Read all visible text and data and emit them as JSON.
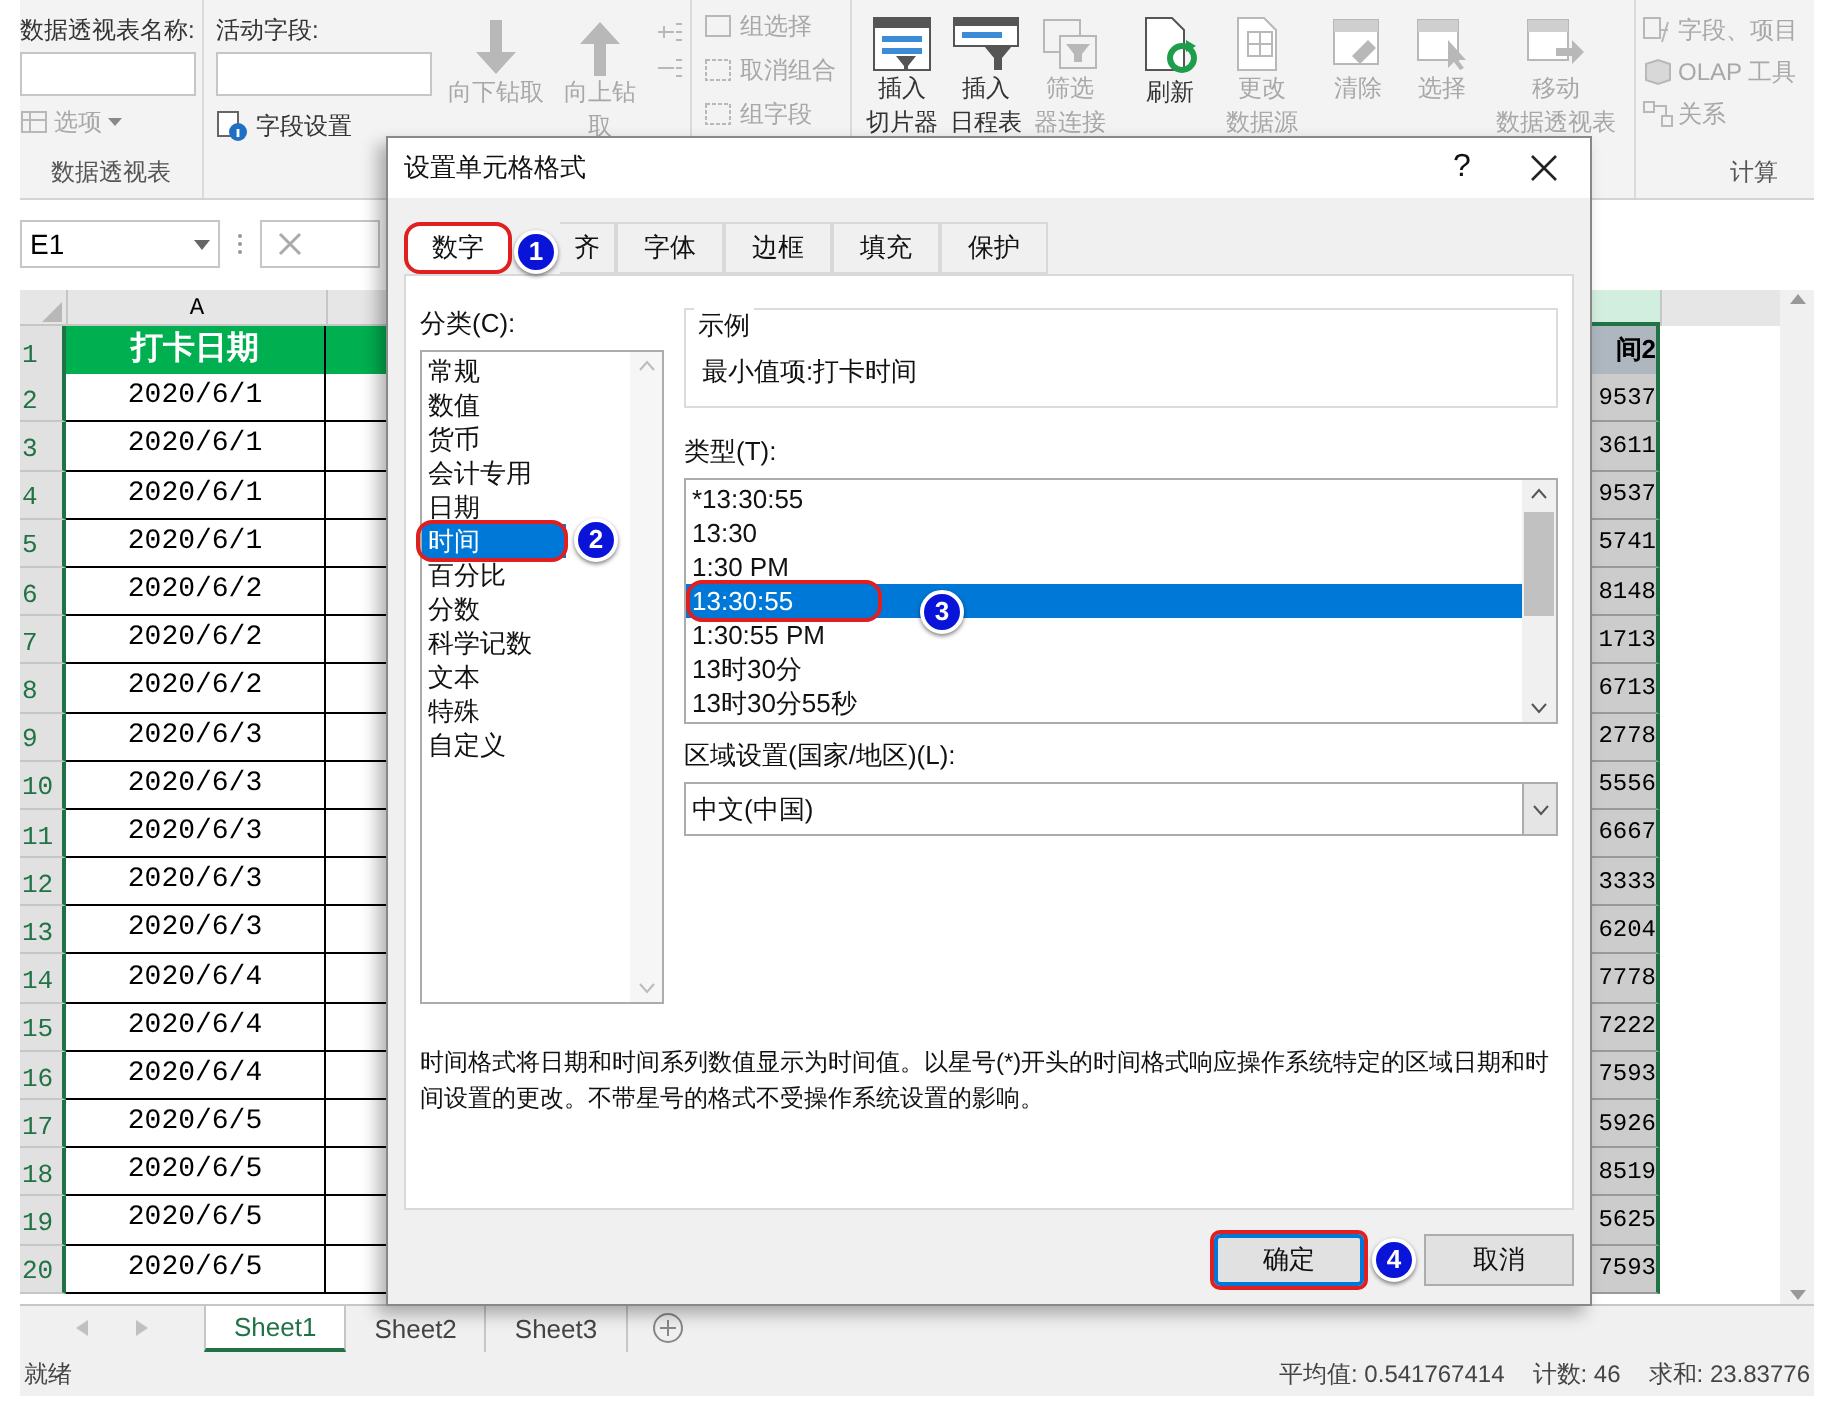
{
  "ribbon": {
    "pivot_name_label": "数据透视表名称:",
    "options": {
      "label": "选项",
      "disabled": true
    },
    "pivot_group_label": "数据透视表",
    "active_field_label": "活动字段:",
    "field_settings": "字段设置",
    "drill_buttons": [
      {
        "kind": "down",
        "lines": [
          "向下钻取"
        ],
        "disabled": true
      },
      {
        "kind": "up",
        "lines": [
          "向上钻",
          "取"
        ],
        "disabled": true
      }
    ],
    "group_commands": [
      {
        "label": "组选择",
        "disabled": true
      },
      {
        "label": "取消组合",
        "disabled": true
      },
      {
        "label": "组字段",
        "disabled": true
      }
    ],
    "large_buttons": [
      {
        "kind": "slicer",
        "lines": [
          "插入",
          "切片器"
        ],
        "disabled": false
      },
      {
        "kind": "timeline",
        "lines": [
          "插入",
          "日程表"
        ],
        "disabled": false
      },
      {
        "kind": "filter",
        "lines": [
          "筛选",
          "器连接"
        ],
        "disabled": true
      },
      {
        "kind": "refresh",
        "lines": [
          "刷新"
        ],
        "disabled": false
      },
      {
        "kind": "source",
        "lines": [
          "更改",
          "数据源"
        ],
        "disabled": true
      },
      {
        "kind": "clear",
        "lines": [
          "清除"
        ],
        "disabled": true
      },
      {
        "kind": "select",
        "lines": [
          "选择"
        ],
        "disabled": true
      },
      {
        "kind": "move",
        "lines": [
          "移动",
          "数据透视表"
        ],
        "disabled": true
      }
    ],
    "calc_commands": [
      {
        "kind": "fx",
        "label": "字段、项目"
      },
      {
        "kind": "olap",
        "label": "OLAP 工具"
      },
      {
        "kind": "relation",
        "label": "关系"
      }
    ],
    "calc_group_label": "计算"
  },
  "name_box": "E1",
  "column_headers": [
    "A"
  ],
  "header_row": {
    "a": "打卡日期",
    "e": "间2"
  },
  "rows": [
    {
      "num": "1"
    },
    {
      "num": "2",
      "a": "2020/6/1",
      "e": "9537"
    },
    {
      "num": "3",
      "a": "2020/6/1",
      "e": "3611"
    },
    {
      "num": "4",
      "a": "2020/6/1",
      "e": "9537"
    },
    {
      "num": "5",
      "a": "2020/6/1",
      "e": "5741"
    },
    {
      "num": "6",
      "a": "2020/6/2",
      "e": "8148"
    },
    {
      "num": "7",
      "a": "2020/6/2",
      "e": "1713"
    },
    {
      "num": "8",
      "a": "2020/6/2",
      "e": "6713"
    },
    {
      "num": "9",
      "a": "2020/6/3",
      "e": "2778"
    },
    {
      "num": "10",
      "a": "2020/6/3",
      "e": "5556"
    },
    {
      "num": "11",
      "a": "2020/6/3",
      "e": "6667"
    },
    {
      "num": "12",
      "a": "2020/6/3",
      "e": "3333"
    },
    {
      "num": "13",
      "a": "2020/6/3",
      "e": "6204"
    },
    {
      "num": "14",
      "a": "2020/6/4",
      "e": "7778"
    },
    {
      "num": "15",
      "a": "2020/6/4",
      "e": "7222"
    },
    {
      "num": "16",
      "a": "2020/6/4",
      "e": "7593"
    },
    {
      "num": "17",
      "a": "2020/6/5",
      "e": "5926"
    },
    {
      "num": "18",
      "a": "2020/6/5",
      "e": "8519"
    },
    {
      "num": "19",
      "a": "2020/6/5",
      "e": "5625"
    },
    {
      "num": "20",
      "a": "2020/6/5",
      "e": "7593"
    }
  ],
  "sheet_tabs": [
    {
      "label": "Sheet1",
      "selected": true
    },
    {
      "label": "Sheet2",
      "selected": false
    },
    {
      "label": "Sheet3",
      "selected": false
    }
  ],
  "status_bar": {
    "ready": "就绪",
    "stats": [
      "平均值: 0.541767414",
      "计数: 46",
      "求和: 23.83776"
    ]
  },
  "dialog": {
    "title": "设置单元格格式",
    "help": "?",
    "tabs": [
      {
        "label": "数字",
        "selected": true
      },
      {
        "label": "齐",
        "selected": false
      },
      {
        "label": "字体",
        "selected": false
      },
      {
        "label": "边框",
        "selected": false
      },
      {
        "label": "填充",
        "selected": false
      },
      {
        "label": "保护",
        "selected": false
      }
    ],
    "category_label": "分类(C):",
    "categories": [
      {
        "label": "常规",
        "selected": false
      },
      {
        "label": "数值",
        "selected": false
      },
      {
        "label": "货币",
        "selected": false
      },
      {
        "label": "会计专用",
        "selected": false
      },
      {
        "label": "日期",
        "selected": false
      },
      {
        "label": "时间",
        "selected": true
      },
      {
        "label": "百分比",
        "selected": false
      },
      {
        "label": "分数",
        "selected": false
      },
      {
        "label": "科学记数",
        "selected": false
      },
      {
        "label": "文本",
        "selected": false
      },
      {
        "label": "特殊",
        "selected": false
      },
      {
        "label": "自定义",
        "selected": false
      }
    ],
    "sample_label": "示例",
    "sample_value": "最小值项:打卡时间",
    "type_label": "类型(T):",
    "types": [
      {
        "label": "*13:30:55",
        "selected": false
      },
      {
        "label": "13:30",
        "selected": false
      },
      {
        "label": "1:30 PM",
        "selected": false
      },
      {
        "label": "13:30:55",
        "selected": true
      },
      {
        "label": "1:30:55 PM",
        "selected": false
      },
      {
        "label": "13时30分",
        "selected": false
      },
      {
        "label": "13时30分55秒",
        "selected": false
      }
    ],
    "locale_label": "区域设置(国家/地区)(L):",
    "locale_value": "中文(中国)",
    "description": "时间格式将日期和时间系列数值显示为时间值。以星号(*)开头的时间格式响应操作系统特定的区域日期和时间设置的更改。不带星号的格式不受操作系统设置的影响。",
    "ok": "确定",
    "cancel": "取消"
  },
  "callouts": [
    {
      "number": "1"
    },
    {
      "number": "2"
    },
    {
      "number": "3"
    },
    {
      "number": "4"
    }
  ]
}
